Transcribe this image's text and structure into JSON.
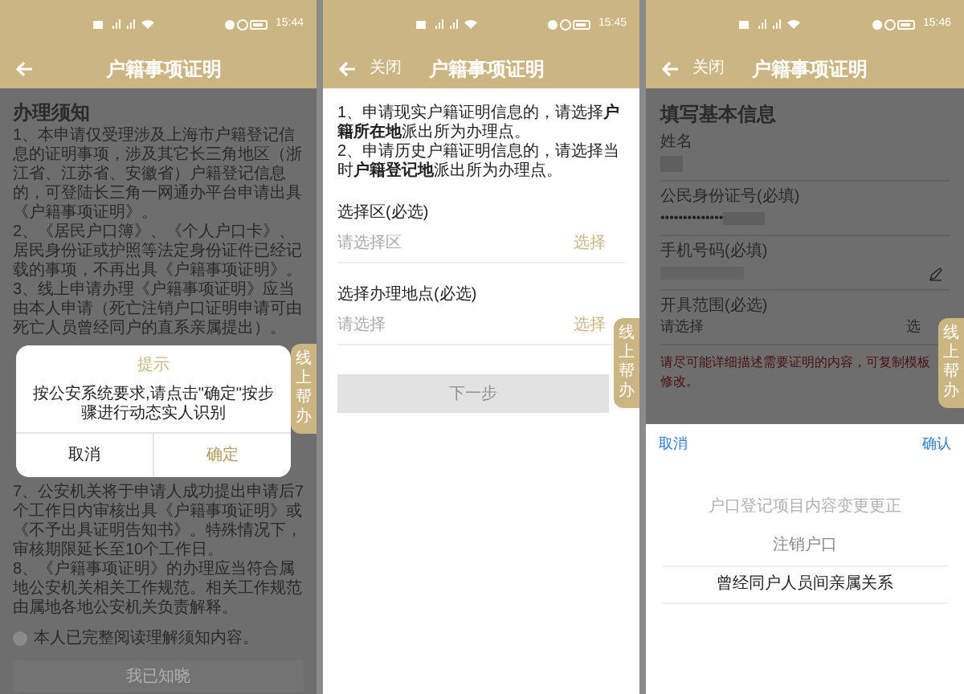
{
  "screens": [
    {
      "kind": "notice",
      "status_bar": {
        "time": "15:44"
      },
      "header": {
        "title": "户籍事项证明"
      },
      "help_tab": {
        "label": "线上帮办"
      },
      "heading": "办理须知",
      "paragraphs_top": [
        "1、本申请仅受理涉及上海市户籍登记信息的证明事项，涉及其它长三角地区（浙江省、江苏省、安徽省）户籍登记信息的，可登陆长三角一网通办平台申请出具《户籍事项证明》。",
        "2、《居民户口簿》、《个人户口卡》、居民身份证或护照等法定身份证件已经记载的事项，不再出具《户籍事项证明》。",
        "3、线上申请办理《户籍事项证明》应当由本人申请（死亡注销户口证明申请可由死亡人员曾经同户的直系亲属提出）。"
      ],
      "dialog": {
        "title": "提示",
        "message": "按公安系统要求,请点击\"确定\"按步骤进行动态实人识别",
        "buttons": [
          {
            "label": "取消",
            "primary": false
          },
          {
            "label": "确定",
            "primary": true
          }
        ]
      },
      "paragraphs_bottom": [
        "7、公安机关将于申请人成功提出申请后7个工作日内审核出具《户籍事项证明》或《不予出具证明告知书》。特殊情况下，审核期限延长至10个工作日。",
        "8、《户籍事项证明》的办理应当符合属地公安机关相关工作规范。相关工作规范由属地各地公安机关负责解释。"
      ],
      "agree": {
        "label": "本人已完整阅读理解须知内容。",
        "checked": false
      },
      "button": {
        "label": "我已知晓",
        "disabled": true
      }
    },
    {
      "kind": "location",
      "status_bar": {
        "time": "15:45"
      },
      "header": {
        "close_label": "关闭",
        "title": "户籍事项证明"
      },
      "help_tab": {
        "label": "线上帮办"
      },
      "instructions": [
        "1、申请现实户籍证明信息的，请选择**户籍所在地**派出所为办理点。",
        "2、申请历史户籍证明信息的，请选择当时**户籍登记地**派出所为办理点。"
      ],
      "fields": [
        {
          "label": "选择区(必选)",
          "placeholder": "请选择区",
          "action": "选择"
        },
        {
          "label": "选择办理地点(必选)",
          "placeholder": "请选择",
          "action": "选择"
        }
      ],
      "button": {
        "label": "下一步",
        "disabled": true
      }
    },
    {
      "kind": "form",
      "status_bar": {
        "time": "15:46"
      },
      "header": {
        "close_label": "关闭",
        "title": "户籍事项证明"
      },
      "help_tab": {
        "label": "线上帮办"
      },
      "heading": "填写基本信息",
      "fields": [
        {
          "label": "姓名",
          "kind": "blurred"
        },
        {
          "label": "公民身份证号(必填)",
          "kind": "masked",
          "value": "••••••••••••••"
        },
        {
          "label": "手机号码(必填)",
          "kind": "editable"
        },
        {
          "label": "开具范围(必选)",
          "kind": "select",
          "placeholder": "请选择",
          "action": "选"
        }
      ],
      "hint_lines": [
        "请尽可能详细描述需要证明的内容，可复制模板",
        "修改。"
      ],
      "picker": {
        "cancel": "取消",
        "confirm": "确认",
        "options": [
          {
            "label": "户口登记项目内容变更更正",
            "selected": false
          },
          {
            "label": "注销户口",
            "selected": false
          },
          {
            "label": "曾经同户人员间亲属关系",
            "selected": true
          }
        ]
      }
    }
  ]
}
